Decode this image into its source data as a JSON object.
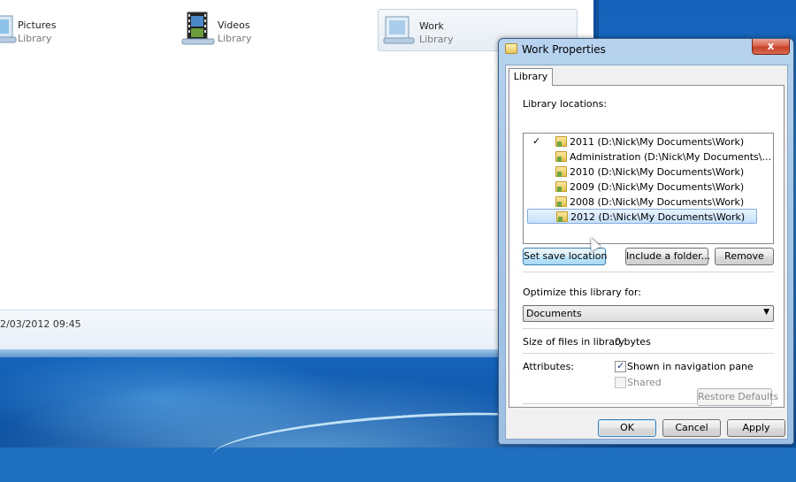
{
  "explorer": {
    "libraries": [
      {
        "name": "Pictures",
        "sub": "Library",
        "icon": "pictures-library-icon"
      },
      {
        "name": "Videos",
        "sub": "Library",
        "icon": "videos-library-icon"
      },
      {
        "name": "Work",
        "sub": "Library",
        "icon": "work-library-icon"
      }
    ],
    "details_date": "2/03/2012 09:45"
  },
  "dialog": {
    "title": "Work Properties",
    "close_label": "x",
    "tab_label": "Library",
    "locations_label": "Library locations:",
    "locations": [
      {
        "text": "2011 (D:\\Nick\\My Documents\\Work)",
        "default_save": true
      },
      {
        "text": "Administration (D:\\Nick\\My Documents\\...",
        "default_save": false
      },
      {
        "text": "2010 (D:\\Nick\\My Documents\\Work)",
        "default_save": false
      },
      {
        "text": "2009 (D:\\Nick\\My Documents\\Work)",
        "default_save": false
      },
      {
        "text": "2008 (D:\\Nick\\My Documents\\Work)",
        "default_save": false
      },
      {
        "text": "2012 (D:\\Nick\\My Documents\\Work)",
        "default_save": false,
        "selected": true
      }
    ],
    "check_mark": "✓",
    "buttons": {
      "set_save": "Set save location",
      "include_folder": "Include a folder...",
      "remove": "Remove",
      "restore": "Restore Defaults",
      "ok": "OK",
      "cancel": "Cancel",
      "apply": "Apply"
    },
    "optimize_label": "Optimize this library for:",
    "optimize_value": "Documents",
    "size_label": "Size of files in library:",
    "size_value": "0 bytes",
    "attributes_label": "Attributes:",
    "shown_in_nav_label": "Shown in navigation pane",
    "shown_in_nav_checked": true,
    "shared_label": "Shared",
    "shared_checked": false
  }
}
